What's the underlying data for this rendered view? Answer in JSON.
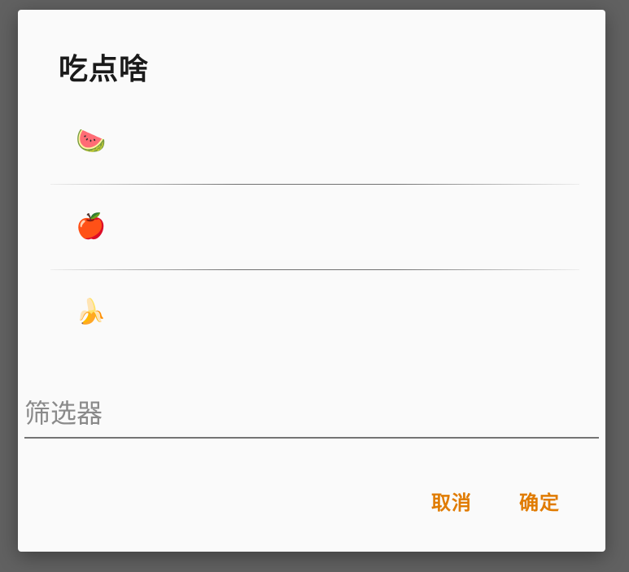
{
  "dialog": {
    "title": "吃点啥",
    "items": [
      {
        "emoji": "🍉",
        "icon_name": "watermelon-icon"
      },
      {
        "emoji": "🍎",
        "icon_name": "apple-icon"
      },
      {
        "emoji": "🍌",
        "icon_name": "banana-icon"
      }
    ],
    "filter": {
      "placeholder": "筛选器",
      "value": ""
    },
    "buttons": {
      "cancel_label": "取消",
      "confirm_label": "确定"
    },
    "colors": {
      "accent": "#e07b00",
      "overlay": "#616161",
      "surface": "#fafafa"
    }
  }
}
